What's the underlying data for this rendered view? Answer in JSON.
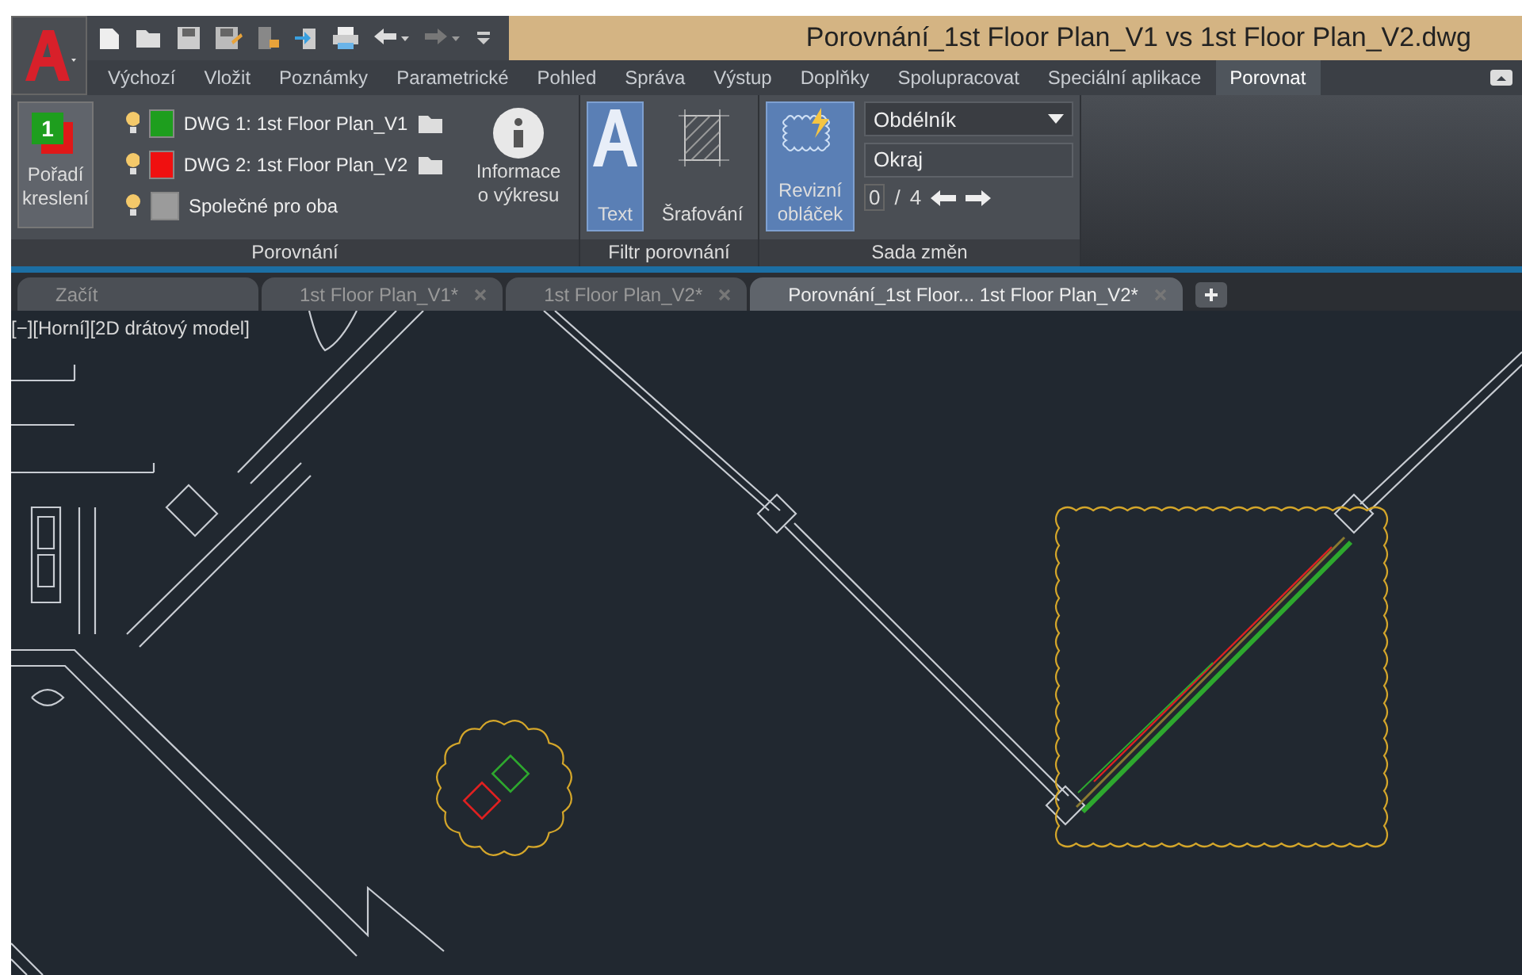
{
  "title_bar": {
    "title": "Porovnání_1st Floor Plan_V1 vs 1st Floor Plan_V2.dwg"
  },
  "ribbon_tabs": [
    {
      "label": "Výchozí",
      "selected": false
    },
    {
      "label": "Vložit",
      "selected": false
    },
    {
      "label": "Poznámky",
      "selected": false
    },
    {
      "label": "Parametrické",
      "selected": false
    },
    {
      "label": "Pohled",
      "selected": false
    },
    {
      "label": "Správa",
      "selected": false
    },
    {
      "label": "Výstup",
      "selected": false
    },
    {
      "label": "Doplňky",
      "selected": false
    },
    {
      "label": "Spolupracovat",
      "selected": false
    },
    {
      "label": "Speciální aplikace",
      "selected": false
    },
    {
      "label": "Porovnat",
      "selected": true
    }
  ],
  "compare_panel": {
    "title": "Porovnání",
    "draw_order": {
      "badge": "1",
      "label": "Pořadí kreslení"
    },
    "layers": [
      {
        "kind": "drawing",
        "label": "DWG 1:  1st Floor Plan_V1",
        "color": "#1e9e1e",
        "visible": true
      },
      {
        "kind": "drawing",
        "label": "DWG 2:  1st Floor Plan_V2",
        "color": "#f01010",
        "visible": true
      },
      {
        "kind": "common",
        "label": "Společné pro oba",
        "color": "#9b9b9b",
        "visible": true
      }
    ],
    "info_button": {
      "label": "Informace o výkresu"
    }
  },
  "filter_panel": {
    "title": "Filtr porovnání",
    "filters": [
      {
        "kind": "text",
        "label": "Text",
        "selected": true
      },
      {
        "kind": "hatch",
        "label": "Šrafování",
        "selected": false
      }
    ]
  },
  "change_set_panel": {
    "title": "Sada změn",
    "cloud_button": {
      "label": "Revizní obláček",
      "selected": true
    },
    "shape_dropdown": "Obdélník",
    "margin_field": "Okraj",
    "counter": {
      "current": "0",
      "separator": "/",
      "total": "4"
    }
  },
  "document_tabs": [
    {
      "label": "Začít",
      "selected": false,
      "closable": false
    },
    {
      "label": "1st Floor Plan_V1*",
      "selected": false,
      "closable": true
    },
    {
      "label": "1st Floor Plan_V2*",
      "selected": false,
      "closable": true
    },
    {
      "label": "Porovnání_1st Floor... 1st Floor Plan_V2*",
      "selected": true,
      "closable": true
    }
  ],
  "viewport": {
    "label": "[−][Horní][2D drátový model]"
  }
}
